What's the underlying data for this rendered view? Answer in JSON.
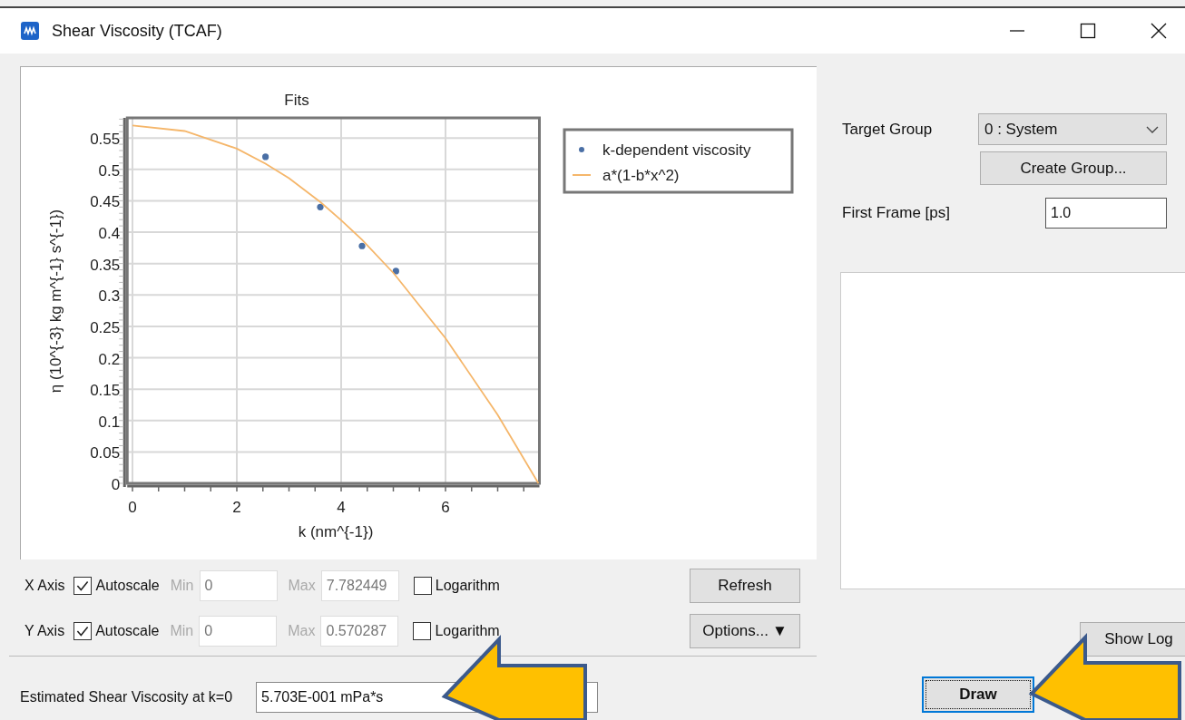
{
  "window": {
    "title": "Shear Viscosity (TCAF)"
  },
  "chart": {
    "chart_data": {
      "type": "line",
      "title": "Fits",
      "xlabel": "k (nm^{-1})",
      "ylabel": "η (10^{-3} kg m^{-1} s^{-1})",
      "x": [
        0,
        1,
        2,
        2.55,
        3,
        3.6,
        4,
        4.4,
        5,
        5.05,
        6,
        7,
        7.78
      ],
      "series": [
        {
          "name": "k-dependent viscosity",
          "color": "#4a6fa5",
          "type": "scatter",
          "values": [
            null,
            null,
            null,
            0.52,
            null,
            0.44,
            null,
            0.378,
            null,
            0.338,
            null,
            null,
            null
          ]
        },
        {
          "name": "a*(1-b*x^2)",
          "color": "#f5b66a",
          "type": "line",
          "values": [
            0.57,
            0.561,
            0.533,
            0.509,
            0.486,
            0.448,
            0.419,
            0.388,
            0.335,
            0.33,
            0.231,
            0.109,
            0
          ]
        }
      ],
      "grid": true,
      "legend": true,
      "xlim": [
        -0.1,
        7.8
      ],
      "ylim": [
        0,
        0.582
      ],
      "xticks": [
        0,
        2,
        4,
        6
      ],
      "yticks": [
        {
          "value": 0,
          "label": "0"
        },
        {
          "value": 0.05,
          "label": "0.05"
        },
        {
          "value": 0.1,
          "label": "0.1"
        },
        {
          "value": 0.15,
          "label": "0.15"
        },
        {
          "value": 0.2,
          "label": "0.2"
        },
        {
          "value": 0.25,
          "label": "0.25"
        },
        {
          "value": 0.3,
          "label": "0.3"
        },
        {
          "value": 0.35,
          "label": "0.35"
        },
        {
          "value": 0.4,
          "label": "0.4"
        },
        {
          "value": 0.45,
          "label": "0.45"
        },
        {
          "value": 0.5,
          "label": "0.5"
        },
        {
          "value": 0.55,
          "label": "0.55"
        }
      ]
    }
  },
  "axes": [
    {
      "label": "X Axis",
      "autoscale": {
        "label": "Autoscale",
        "checked": true
      },
      "min_label": "Min",
      "min": "0",
      "max_label": "Max",
      "max": "7.782449",
      "disabled": true,
      "log": {
        "label": "Logarithm",
        "checked": false
      }
    },
    {
      "label": "Y Axis",
      "autoscale": {
        "label": "Autoscale",
        "checked": true
      },
      "min_label": "Min",
      "min": "0",
      "max_label": "Max",
      "max": "0.570287",
      "disabled": true,
      "log": {
        "label": "Logarithm",
        "checked": false
      }
    }
  ],
  "buttons": {
    "refresh": "Refresh",
    "options": "Options...",
    "options_caret": "▼"
  },
  "estimate": {
    "label": "Estimated Shear Viscosity at k=0",
    "value": "5.703E-001 mPa*s"
  },
  "target_group": {
    "label": "Target Group",
    "value": "0 : System"
  },
  "create_group": "Create Group...",
  "first_frame": {
    "label": "First Frame [ps]",
    "value": "1.0"
  },
  "show_log": "Show Log",
  "draw": {
    "label": "Draw",
    "focused": true
  }
}
